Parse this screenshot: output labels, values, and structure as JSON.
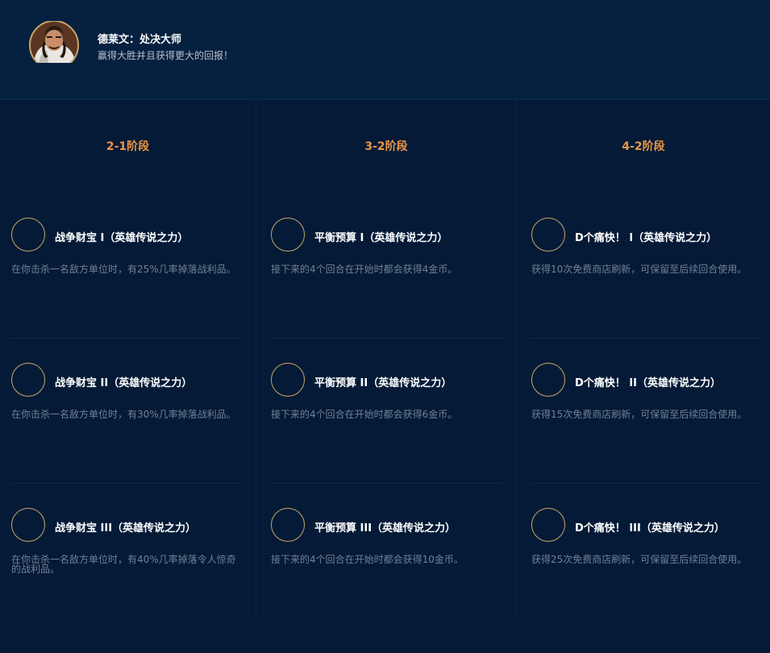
{
  "header": {
    "title": "德莱文：处决大师",
    "subtitle": "赢得大胜并且获得更大的回报！"
  },
  "columns": [
    {
      "stage": "2-1阶段",
      "augments": [
        {
          "name": "战争财宝 I（英雄传说之力）",
          "desc": "在你击杀一名敌方单位时，有25%几率掉落战利品。"
        },
        {
          "name": "战争财宝 II（英雄传说之力）",
          "desc": "在你击杀一名敌方单位时，有30%几率掉落战利品。"
        },
        {
          "name": "战争财宝 III（英雄传说之力）",
          "desc": "在你击杀一名敌方单位时，有40%几率掉落令人惊奇的战利品。"
        }
      ]
    },
    {
      "stage": "3-2阶段",
      "augments": [
        {
          "name": "平衡预算 I（英雄传说之力）",
          "desc": "接下来的4个回合在开始时都会获得4金币。"
        },
        {
          "name": "平衡预算 II（英雄传说之力）",
          "desc": "接下来的4个回合在开始时都会获得6金币。"
        },
        {
          "name": "平衡预算 III（英雄传说之力）",
          "desc": "接下来的4个回合在开始时都会获得10金币。"
        }
      ]
    },
    {
      "stage": "4-2阶段",
      "augments": [
        {
          "name": "D个痛快！ I（英雄传说之力）",
          "desc": "获得10次免费商店刷新，可保留至后续回合使用。"
        },
        {
          "name": "D个痛快！ II（英雄传说之力）",
          "desc": "获得15次免费商店刷新，可保留至后续回合使用。"
        },
        {
          "name": "D个痛快！ III（英雄传说之力）",
          "desc": "获得25次免费商店刷新，可保留至后续回合使用。"
        }
      ]
    }
  ],
  "colors": {
    "background": "#041a36",
    "header_bg": "#06203f",
    "stage_label": "#e99646",
    "ring_gold": "#c6a569",
    "desc_text": "#6f8197"
  },
  "icons": {
    "avatar": "draven-portrait-icon",
    "augment": "augment-slot-ring-icon"
  }
}
